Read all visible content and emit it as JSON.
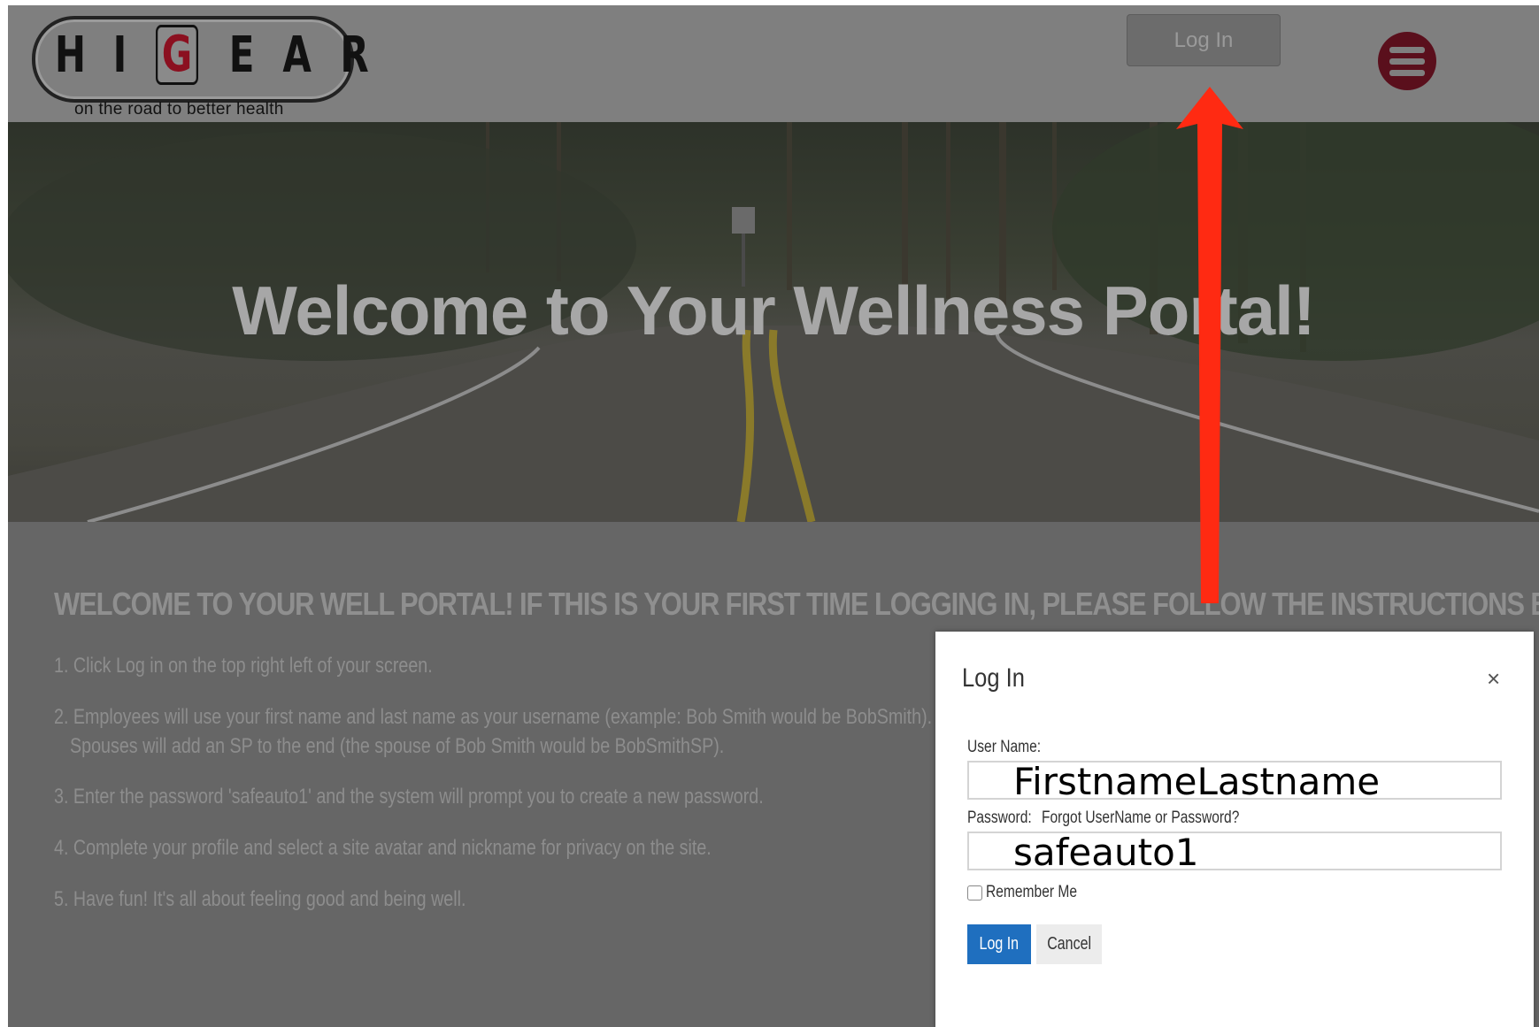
{
  "header": {
    "logo_letters": [
      "H",
      "I",
      "G",
      "E",
      "A",
      "R"
    ],
    "logo_tagline": "on the road to better health",
    "login_button": "Log In",
    "menu_icon": "hamburger-menu-icon"
  },
  "hero": {
    "title": "Welcome to Your Wellness Portal!"
  },
  "instructions": {
    "heading": "WELCOME TO YOUR WELL PORTAL!  IF THIS IS YOUR FIRST TIME LOGGING IN, PLEASE FOLLOW THE INSTRUCTIONS BELOW:",
    "steps": [
      "1. Click Log in on the top right left of your screen.",
      "2. Employees will use your first name and last name as your username (example: Bob Smith would be BobSmith).",
      "Spouses will add an SP to the end (the spouse of Bob Smith would be BobSmithSP).",
      "3. Enter the password 'safeauto1' and the system will prompt you to create a new password.",
      "4. Complete your profile and select a site avatar and nickname for privacy on the site.",
      "5. Have fun! It's all about feeling good and being well."
    ]
  },
  "login_dialog": {
    "title": "Log In",
    "close_symbol": "×",
    "username_label": "User Name:",
    "username_value": "FirstnameLastname",
    "password_label": "Password:",
    "forgot_link": "Forgot UserName or Password?",
    "password_value": "safeauto1",
    "remember_label": "Remember Me",
    "remember_checked": false,
    "login_button": "Log In",
    "cancel_button": "Cancel"
  },
  "colors": {
    "menu_button": "#5a0f1c",
    "login_button_blue": "#1f6fbf",
    "annotation_arrow": "#ff2a12"
  }
}
